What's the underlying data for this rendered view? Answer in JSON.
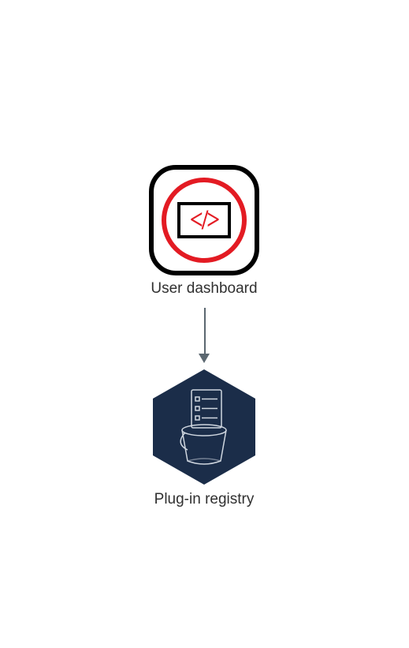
{
  "diagram": {
    "nodes": {
      "dashboard": {
        "label": "User dashboard",
        "icon": "code-monitor-icon",
        "shape": "rounded-square",
        "colors": {
          "border": "#000000",
          "ring": "#e31b23",
          "screen_border": "#000000",
          "glyph": "#e31b23"
        }
      },
      "registry": {
        "label": "Plug-in registry",
        "icon": "bucket-list-icon",
        "shape": "hexagon",
        "colors": {
          "fill": "#1b2d49",
          "stroke": "#ffffff"
        }
      }
    },
    "edges": [
      {
        "from": "dashboard",
        "to": "registry",
        "style": "arrow",
        "color": "#5b6770"
      }
    ]
  }
}
